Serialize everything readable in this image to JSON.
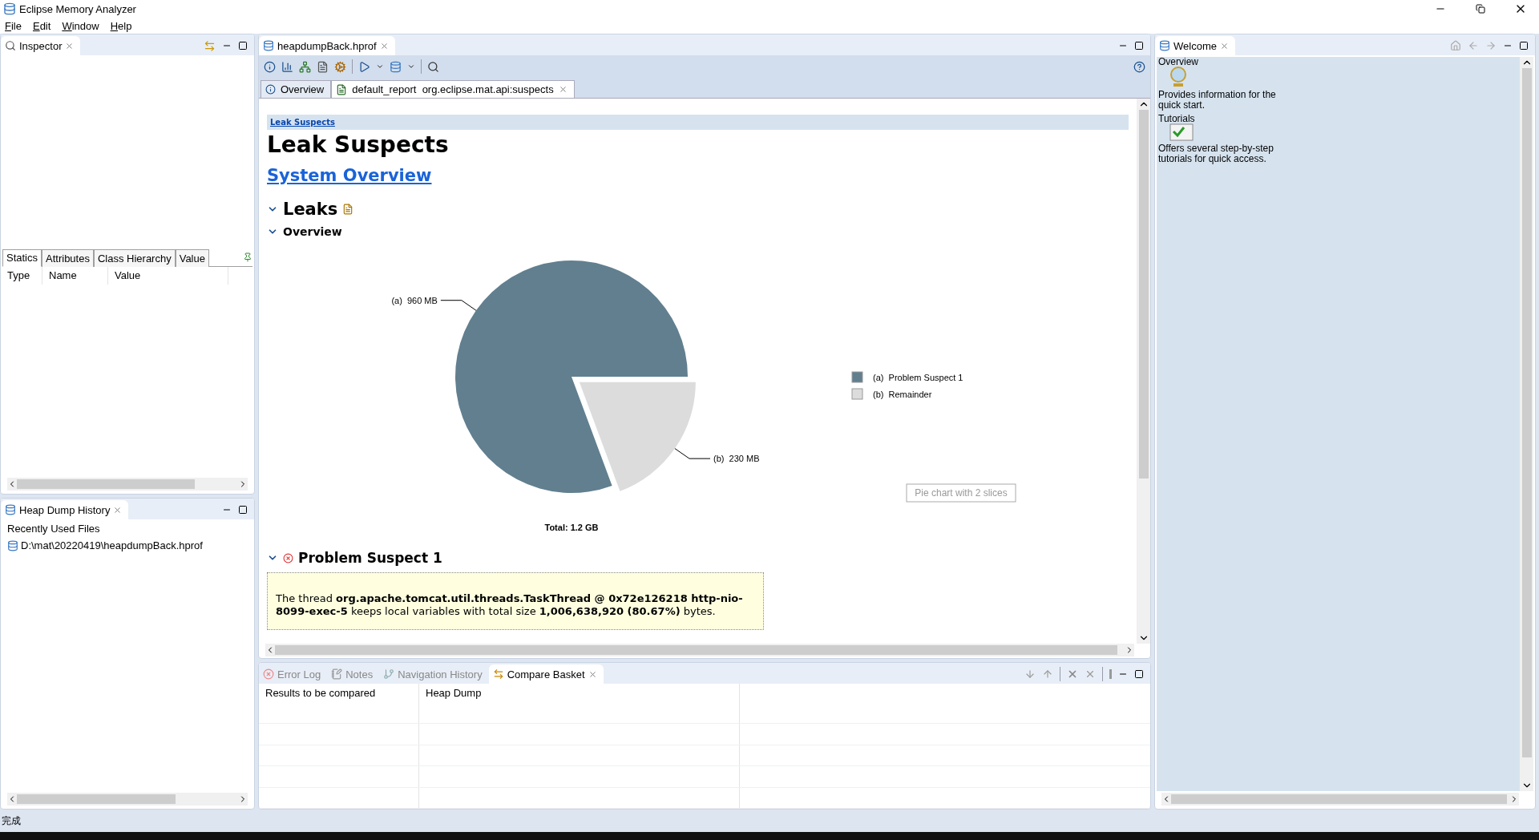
{
  "window": {
    "title": "Eclipse Memory Analyzer"
  },
  "menu": [
    {
      "label": "File"
    },
    {
      "label": "Edit"
    },
    {
      "label": "Window"
    },
    {
      "label": "Help"
    }
  ],
  "inspector": {
    "tab": "Inspector",
    "subtabs": [
      {
        "label": "Statics",
        "selected": true
      },
      {
        "label": "Attributes",
        "selected": false
      },
      {
        "label": "Class Hierarchy",
        "selected": false
      },
      {
        "label": "Value",
        "selected": false
      }
    ],
    "columns": [
      "Type",
      "Name",
      "Value"
    ]
  },
  "heap_dump_history": {
    "tab": "Heap Dump History",
    "heading": "Recently Used Files",
    "files": [
      "D:\\mat\\20220419\\heapdumpBack.hprof"
    ]
  },
  "editor": {
    "tab": "heapdumpBack.hprof",
    "subtabs": [
      {
        "label": "Overview",
        "selected": false,
        "kind": "info"
      },
      {
        "label": "default_report  org.eclipse.mat.api:suspects",
        "selected": true,
        "kind": "report"
      }
    ],
    "report": {
      "breadcrumb": "Leak Suspects",
      "title": "Leak Suspects",
      "link": "System Overview",
      "sections": [
        {
          "title": "Leaks",
          "expanded": true
        },
        {
          "title": "Overview",
          "expanded": true
        }
      ],
      "chart": {
        "legend": [
          {
            "color": "#617f8f"
          },
          {
            "color": "#dcdcdc"
          }
        ],
        "total": "Total: 1.2 GB",
        "alt_text": "Pie chart with 2 slices",
        "chart_data": {
          "type": "pie",
          "categories": [
            "(a)  Problem Suspect 1",
            "(b)  Remainder"
          ],
          "values": [
            960,
            230
          ],
          "value_labels": [
            "(a)  960 MB",
            "(b)  230 MB"
          ],
          "legend": "right"
        }
      },
      "suspect": {
        "title": "Problem Suspect 1",
        "expanded": true,
        "description": "The thread **org.apache.tomcat.util.threads.TaskThread @ 0x72e126218 http-nio-8099-exec-5** keeps local variables with total size **1,006,638,920 (80.67%)** bytes."
      }
    }
  },
  "bottom_panel": {
    "tabs": [
      {
        "label": "Error Log",
        "selected": false,
        "kind": "error"
      },
      {
        "label": "Notes",
        "selected": false,
        "kind": "notes"
      },
      {
        "label": "Navigation History",
        "selected": false,
        "kind": "history"
      },
      {
        "label": "Compare Basket",
        "selected": true,
        "kind": "compare"
      }
    ],
    "columns": [
      "Results to be compared",
      "Heap Dump"
    ]
  },
  "welcome": {
    "tab": "Welcome",
    "items": [
      {
        "title": "Overview",
        "description": "Provides information for the quick start.",
        "kind": "globe"
      },
      {
        "title": "Tutorials",
        "description": "Offers several step-by-step tutorials for quick access.",
        "kind": "checklist"
      }
    ]
  },
  "status_bar": {
    "message": "完成"
  }
}
